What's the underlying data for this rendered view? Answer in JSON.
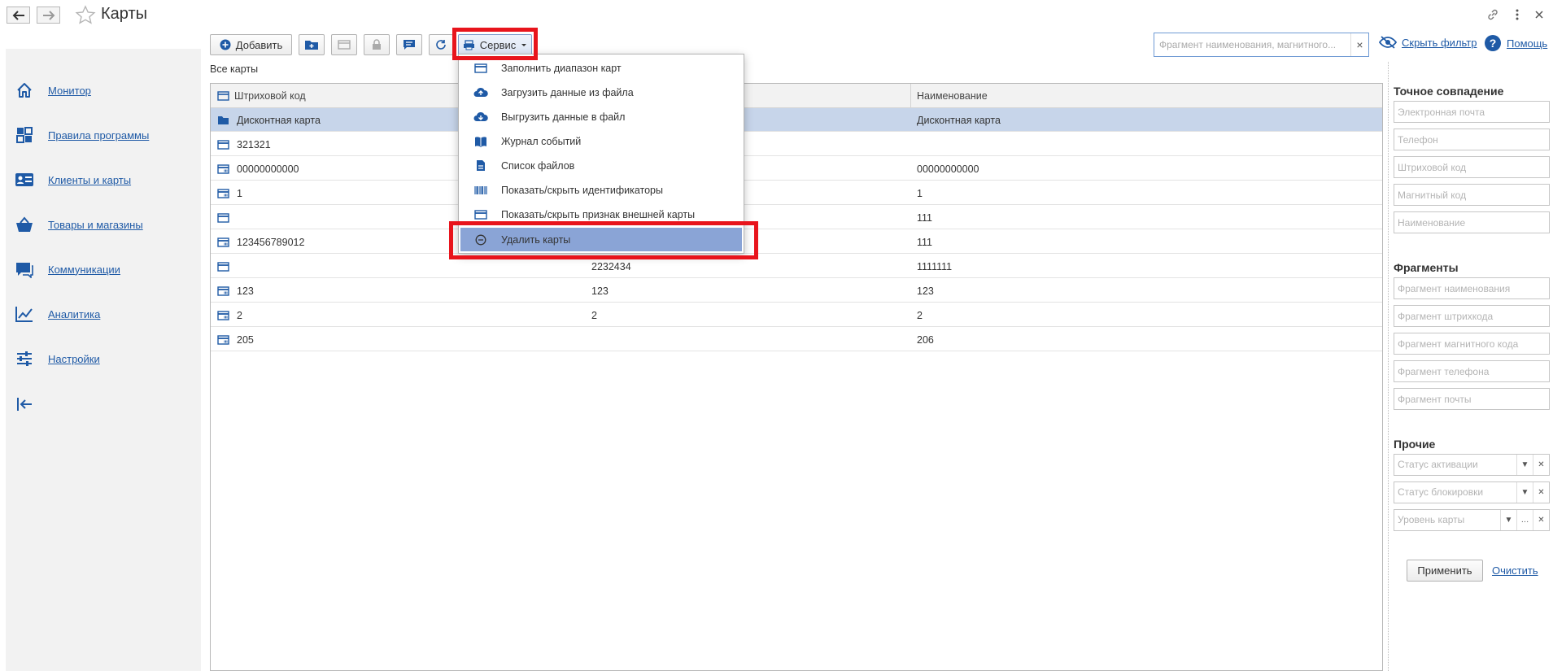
{
  "window": {
    "title": "Карты"
  },
  "sidebar": {
    "items": [
      {
        "label": "Монитор",
        "icon": "home-icon"
      },
      {
        "label": "Правила программы",
        "icon": "grid-icon"
      },
      {
        "label": "Клиенты и карты",
        "icon": "id-card-icon"
      },
      {
        "label": "Товары и магазины",
        "icon": "basket-icon"
      },
      {
        "label": "Коммуникации",
        "icon": "chat-icon"
      },
      {
        "label": "Аналитика",
        "icon": "chart-line-icon"
      },
      {
        "label": "Настройки",
        "icon": "sliders-icon"
      }
    ]
  },
  "toolbar": {
    "add_label": "Добавить",
    "service_label": "Сервис"
  },
  "search": {
    "placeholder": "Фрагмент наименования, магнитного..."
  },
  "header_links": {
    "hide_filter": "Скрыть фильтр",
    "help": "Помощь"
  },
  "list": {
    "caption": "Все карты",
    "columns": [
      "Штриховой код",
      "",
      "Наименование"
    ],
    "rows": [
      {
        "barcode": "Дисконтная карта",
        "magnetic": "",
        "name": "Дисконтная карта",
        "type": "folder",
        "selected": true
      },
      {
        "barcode": "321321",
        "magnetic": "",
        "name": "",
        "type": "card",
        "selected": false
      },
      {
        "barcode": "00000000000",
        "magnetic": "",
        "name": "00000000000",
        "type": "card-barcode",
        "selected": false
      },
      {
        "barcode": "1",
        "magnetic": "",
        "name": "1",
        "type": "card-barcode",
        "selected": false
      },
      {
        "barcode": "",
        "magnetic": "",
        "name": "111",
        "type": "card",
        "selected": false
      },
      {
        "barcode": "123456789012",
        "magnetic": "",
        "name": "111",
        "type": "card-barcode",
        "selected": false
      },
      {
        "barcode": "",
        "magnetic": "2232434",
        "name": "1111111",
        "type": "card",
        "selected": false
      },
      {
        "barcode": "123",
        "magnetic": "123",
        "name": "123",
        "type": "card-barcode",
        "selected": false
      },
      {
        "barcode": "2",
        "magnetic": "2",
        "name": "2",
        "type": "card-barcode",
        "selected": false
      },
      {
        "barcode": "205",
        "magnetic": "",
        "name": "206",
        "type": "card-barcode",
        "selected": false
      }
    ]
  },
  "service_menu": {
    "items": [
      {
        "label": "Заполнить диапазон карт",
        "icon": "card-range-icon"
      },
      {
        "label": "Загрузить данные из файла",
        "icon": "cloud-upload-icon"
      },
      {
        "label": "Выгрузить данные в файл",
        "icon": "cloud-download-icon"
      },
      {
        "label": "Журнал событий",
        "icon": "journal-icon"
      },
      {
        "label": "Список файлов",
        "icon": "file-icon"
      },
      {
        "label": "Показать/скрыть идентификаторы",
        "icon": "barcode-icon"
      },
      {
        "label": "Показать/скрыть признак внешней карты",
        "icon": "card-icon"
      },
      {
        "label": "Удалить карты",
        "icon": "minus-circle-icon",
        "highlighted": true
      }
    ]
  },
  "filter": {
    "exact": {
      "title": "Точное совпадение",
      "fields": [
        "Электронная почта",
        "Телефон",
        "Штриховой код",
        "Магнитный код",
        "Наименование"
      ]
    },
    "fragments": {
      "title": "Фрагменты",
      "fields": [
        "Фрагмент наименования",
        "Фрагмент штрихкода",
        "Фрагмент магнитного кода",
        "Фрагмент телефона",
        "Фрагмент почты"
      ]
    },
    "other": {
      "title": "Прочие",
      "fields": [
        "Статус активации",
        "Статус блокировки",
        "Уровень карты"
      ]
    },
    "apply_label": "Применить",
    "clear_label": "Очистить"
  },
  "colors": {
    "accent": "#1f5aa6",
    "highlight_box": "#e8141c",
    "selected_row": "#c7d5ea",
    "menu_highlight": "#8aa4d6"
  }
}
